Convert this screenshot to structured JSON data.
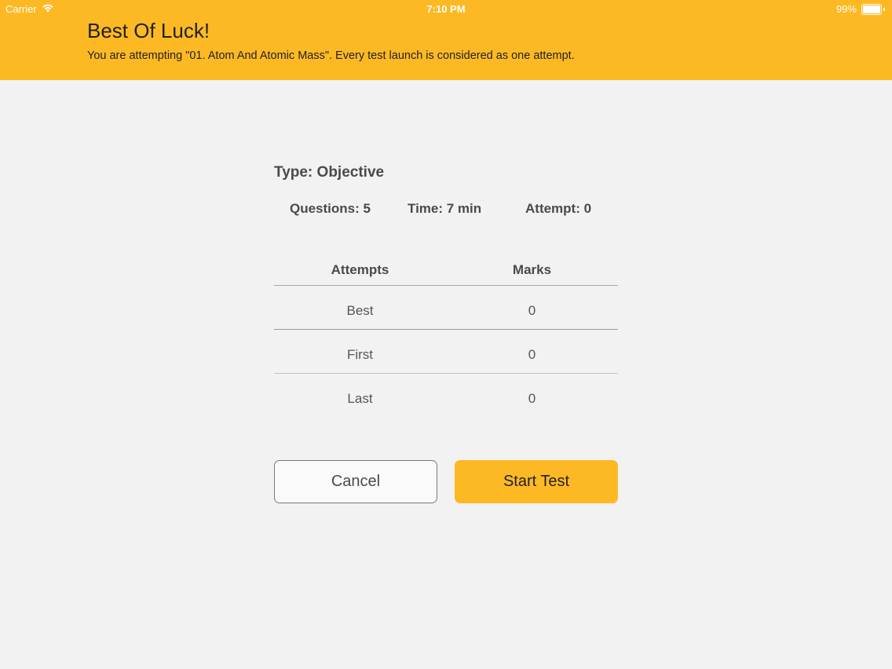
{
  "status_bar": {
    "carrier": "Carrier",
    "time": "7:10 PM",
    "battery": "99%",
    "battery_level": 0.99,
    "wifi_icon": "wifi-icon",
    "battery_icon": "battery-icon"
  },
  "header": {
    "title": "Best Of Luck!",
    "subtitle": "You are attempting \"01. Atom And Atomic Mass\". Every test launch is considered as one attempt.",
    "background_color": "#fdb924"
  },
  "test_info": {
    "type": "Type: Objective",
    "questions": "Questions: 5",
    "time": "Time: 7 min",
    "attempt": "Attempt: 0"
  },
  "table": {
    "headers": [
      "Attempts",
      "Marks"
    ],
    "rows": [
      {
        "label": "Best",
        "marks": "0"
      },
      {
        "label": "First",
        "marks": "0"
      },
      {
        "label": "Last",
        "marks": "0"
      }
    ]
  },
  "buttons": {
    "cancel": "Cancel",
    "start": "Start Test",
    "accent_color": "#fdb924"
  }
}
